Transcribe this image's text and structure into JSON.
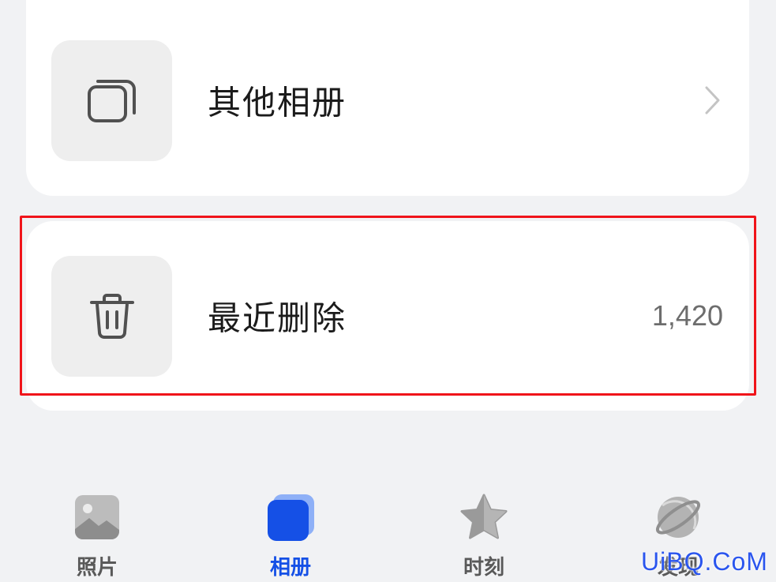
{
  "albums": {
    "other": {
      "icon": "stacked-squares-icon",
      "label": "其他相册"
    },
    "recently_deleted": {
      "icon": "trash-icon",
      "label": "最近删除",
      "count": "1,420"
    }
  },
  "tabbar": {
    "tabs": [
      {
        "id": "photos",
        "label": "照片",
        "icon": "photo-icon",
        "active": false
      },
      {
        "id": "albums",
        "label": "相册",
        "icon": "album-icon",
        "active": true
      },
      {
        "id": "moments",
        "label": "时刻",
        "icon": "star-icon",
        "active": false
      },
      {
        "id": "discover",
        "label": "发现",
        "icon": "planet-icon",
        "active": false
      }
    ]
  },
  "watermark": "UiBQ.CoM",
  "colors": {
    "accent": "#1550e6",
    "highlight": "#f0141a",
    "background": "#f1f2f4"
  }
}
